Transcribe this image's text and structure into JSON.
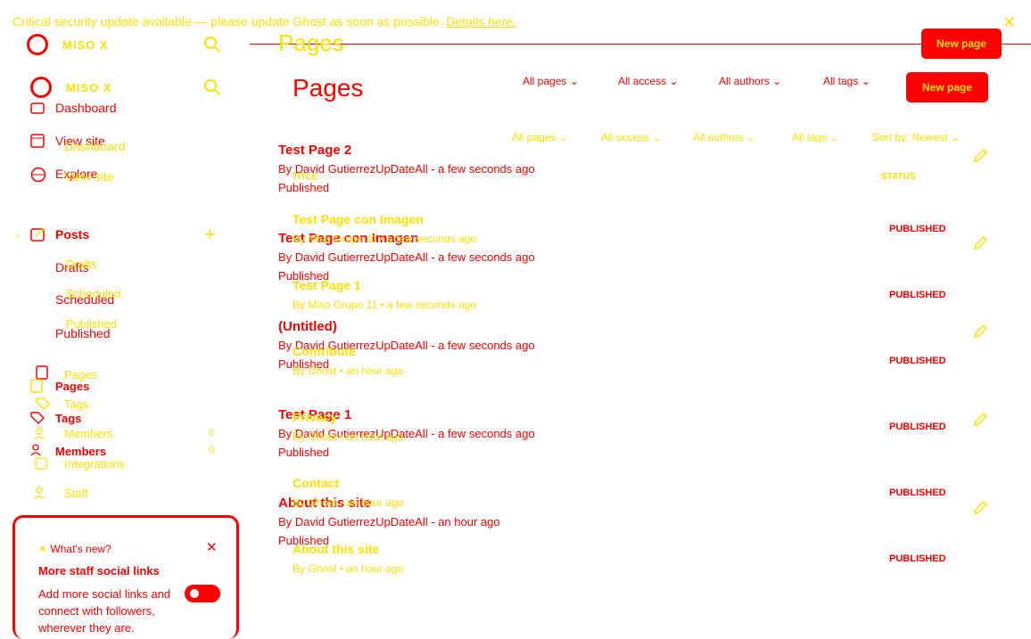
{
  "banner": {
    "text": "Critical security update available — please update Ghost as soon as possible.",
    "link": "Details here.",
    "close_icon": "close-icon"
  },
  "colors": {
    "primary": "#ff0000",
    "secondary": "#ffe000",
    "background": "#ffffff"
  },
  "site": {
    "name": "MISO X"
  },
  "page": {
    "title": "Pages",
    "new_button": "New page"
  },
  "sidebar": {
    "dashboard": "Dashboard",
    "view_site": "View site",
    "explore": "Explore",
    "posts": "Posts",
    "drafts": "Drafts",
    "scheduled": "Scheduled",
    "published": "Published",
    "pages": "Pages",
    "tags": "Tags",
    "members": "Members",
    "members_count": "0",
    "integrations": "Integrations",
    "staff": "Staff"
  },
  "filters": {
    "all_pages": "All pages",
    "all_access": "All access",
    "all_authors": "All authors",
    "all_tags": "All tags",
    "sort": "Sort by: Newest"
  },
  "table": {
    "col_title": "TITLE",
    "col_status": "STATUS"
  },
  "list_a": [
    {
      "title": "Test Page 2",
      "meta": "By David GutierrezUpDateAll - a few seconds ago",
      "status": "Published"
    },
    {
      "title": "Test Page con Imagen",
      "meta": "By David GutierrezUpDateAll - a few seconds ago",
      "status": "Published"
    },
    {
      "title": "(Untitled)",
      "meta": "By David GutierrezUpDateAll - a few seconds ago",
      "status": "Published"
    },
    {
      "title": "Test Page 1",
      "meta": "By David GutierrezUpDateAll - a few seconds ago",
      "status": "Published"
    },
    {
      "title": "About this site",
      "meta": "By David GutierrezUpDateAll - an hour ago",
      "status": "Published"
    }
  ],
  "list_b": [
    {
      "title": "Test Page con Imagen",
      "meta": "By Miso Grupo 11 • a few seconds ago",
      "status": "PUBLISHED"
    },
    {
      "title": "Test Page 1",
      "meta": "By Miso Grupo 11 • a few seconds ago",
      "status": "PUBLISHED"
    },
    {
      "title": "Contribute",
      "meta": "By Ghost • an hour ago",
      "status": "PUBLISHED"
    },
    {
      "title": "Privacy",
      "meta": "By Ghost • an hour ago",
      "status": "PUBLISHED"
    },
    {
      "title": "Contact",
      "meta": "By Ghost • an hour ago",
      "status": "PUBLISHED"
    },
    {
      "title": "About this site",
      "meta": "By Ghost • an hour ago",
      "status": "PUBLISHED"
    }
  ],
  "whats_new": {
    "heading": "What's new?",
    "title": "More staff social links",
    "body": "Add more social links and connect with followers, wherever they are."
  }
}
